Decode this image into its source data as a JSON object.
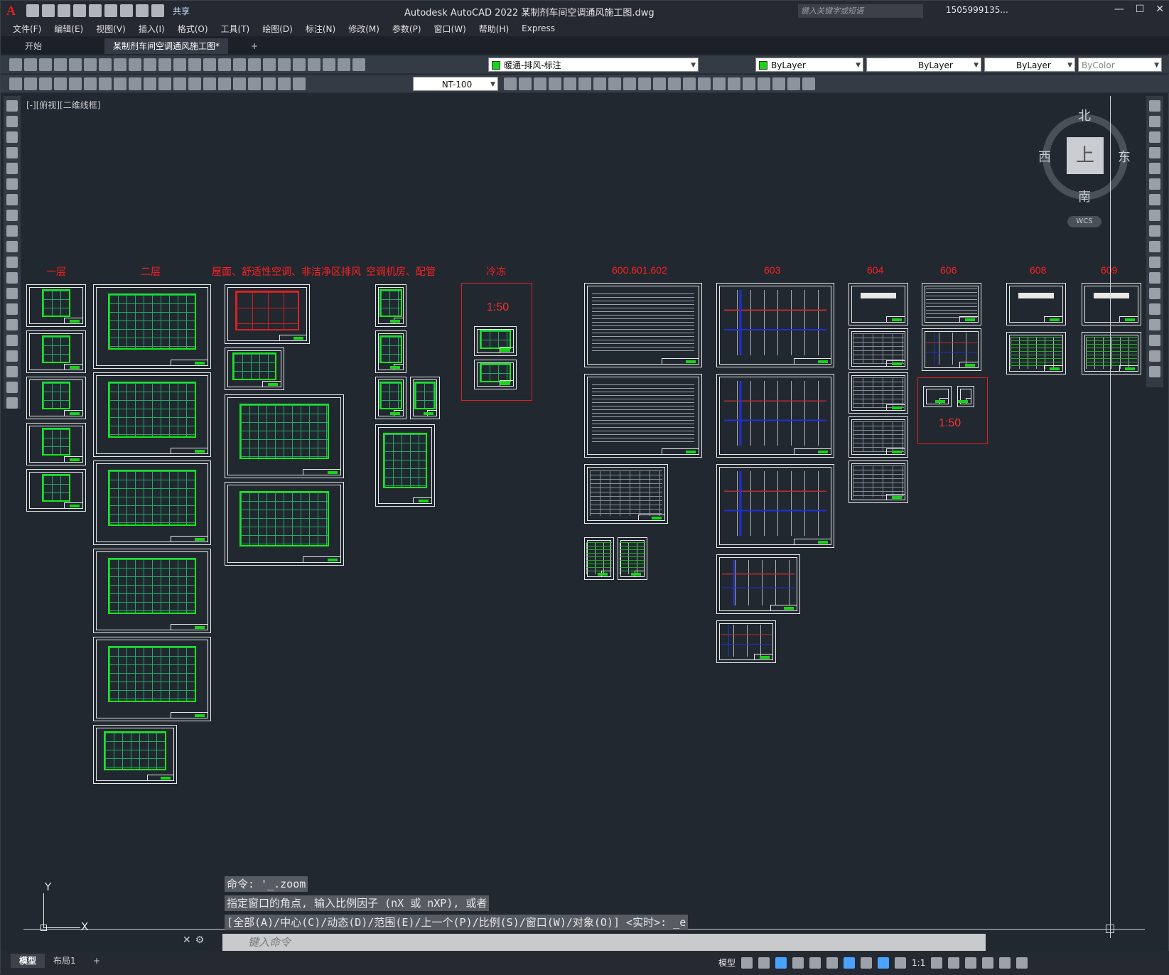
{
  "app": {
    "title": "Autodesk AutoCAD 2022    某制剂车间空调通风施工图.dwg",
    "share_label": "共享",
    "search_placeholder": "键入关键字或短语",
    "user": "1505999135..."
  },
  "menu": [
    "文件(F)",
    "编辑(E)",
    "视图(V)",
    "插入(I)",
    "格式(O)",
    "工具(T)",
    "绘图(D)",
    "标注(N)",
    "修改(M)",
    "参数(P)",
    "窗口(W)",
    "帮助(H)",
    "Express"
  ],
  "file_tabs": {
    "start": "开始",
    "active": "某制剂车间空调通风施工图*",
    "add": "+"
  },
  "toolbar": {
    "layer": "暖通-排风-标注",
    "color": "ByLayer",
    "linetype": "ByLayer",
    "lineweight": "ByLayer",
    "plotstyle": "ByColor",
    "dimstyle": "NT-100",
    "layer_color": "#19d419"
  },
  "viewport_label": "[-][俯视][二维线框]",
  "viewcube": {
    "top": "上",
    "north": "北",
    "south": "南",
    "east": "东",
    "west": "西",
    "wcs": "WCS"
  },
  "groups": {
    "g1": "一层",
    "g2": "二层",
    "g3": "屋面、舒适性空调、非洁净区排风",
    "g4": "空调机房、配管",
    "g5": "冷冻",
    "g6": "600.601.602",
    "g7": "603",
    "g8": "604",
    "g9": "606",
    "g10": "608",
    "g11": "609"
  },
  "scale_labels": {
    "s1": "1:50",
    "s2": "1:50"
  },
  "ucs": {
    "x": "X",
    "y": "Y"
  },
  "command": {
    "history": [
      "命令: '_.zoom",
      "指定窗口的角点, 输入比例因子 (nX 或 nXP), 或者",
      "[全部(A)/中心(C)/动态(D)/范围(E)/上一个(P)/比例(S)/窗口(W)/对象(O)] <实时>: _e"
    ],
    "placeholder": "键入命令"
  },
  "layout_tabs": {
    "model": "模型",
    "layout1": "布局1",
    "add": "+"
  },
  "status": {
    "model": "模型",
    "scale": "1:1"
  },
  "colors": {
    "accent_red": "#ff2020",
    "plan_green": "#19e619",
    "sheet_border": "#e8e8e8",
    "background": "#212830"
  }
}
